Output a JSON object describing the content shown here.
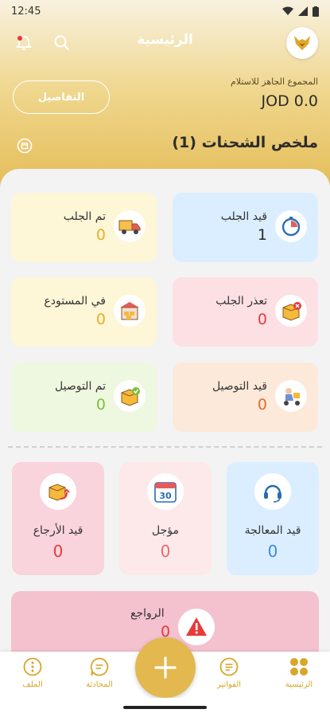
{
  "status_bar": {
    "time": "12:45"
  },
  "header": {
    "title": "الرئيسية",
    "wallet_label": "المجموع الجاهز للاستلام",
    "wallet_amount": "JOD 0.0",
    "details_button": "التفاصيل",
    "summary_title": "ملخص الشحنات (1)"
  },
  "cards": {
    "pending_pickup": {
      "label": "قيد الجلب",
      "value": "1",
      "color": "#dbeeff"
    },
    "picked_up": {
      "label": "تم الجلب",
      "value": "0",
      "color": "#fdf6d7"
    },
    "pickup_failed": {
      "label": "تعذر الجلب",
      "value": "0",
      "color": "#fde0e4"
    },
    "in_warehouse": {
      "label": "في المستودع",
      "value": "0",
      "color": "#fdf6d7"
    },
    "out_for_delivery": {
      "label": "قيد التوصيل",
      "value": "0",
      "color": "#fde9da"
    },
    "delivered": {
      "label": "تم التوصيل",
      "value": "0",
      "color": "#eef7df"
    }
  },
  "big_cards": {
    "processing": {
      "label": "قيد المعالجة",
      "value": "0",
      "color": "#dbeeff"
    },
    "postponed": {
      "label": "مؤجل",
      "value": "0",
      "color": "#fde9ea"
    },
    "returning": {
      "label": "قيد الأرجاع",
      "value": "0",
      "color": "#f9d4dc"
    }
  },
  "returns": {
    "label": "الرواجع",
    "value": "0"
  },
  "nav": {
    "home": "الرئيسية",
    "invoices": "الفواتير",
    "chat": "المحادثة",
    "profile": "الملف"
  },
  "icons": {
    "logo": "fox-logo-icon",
    "search": "search-icon",
    "notification": "bell-icon",
    "calendar_day": "30"
  }
}
